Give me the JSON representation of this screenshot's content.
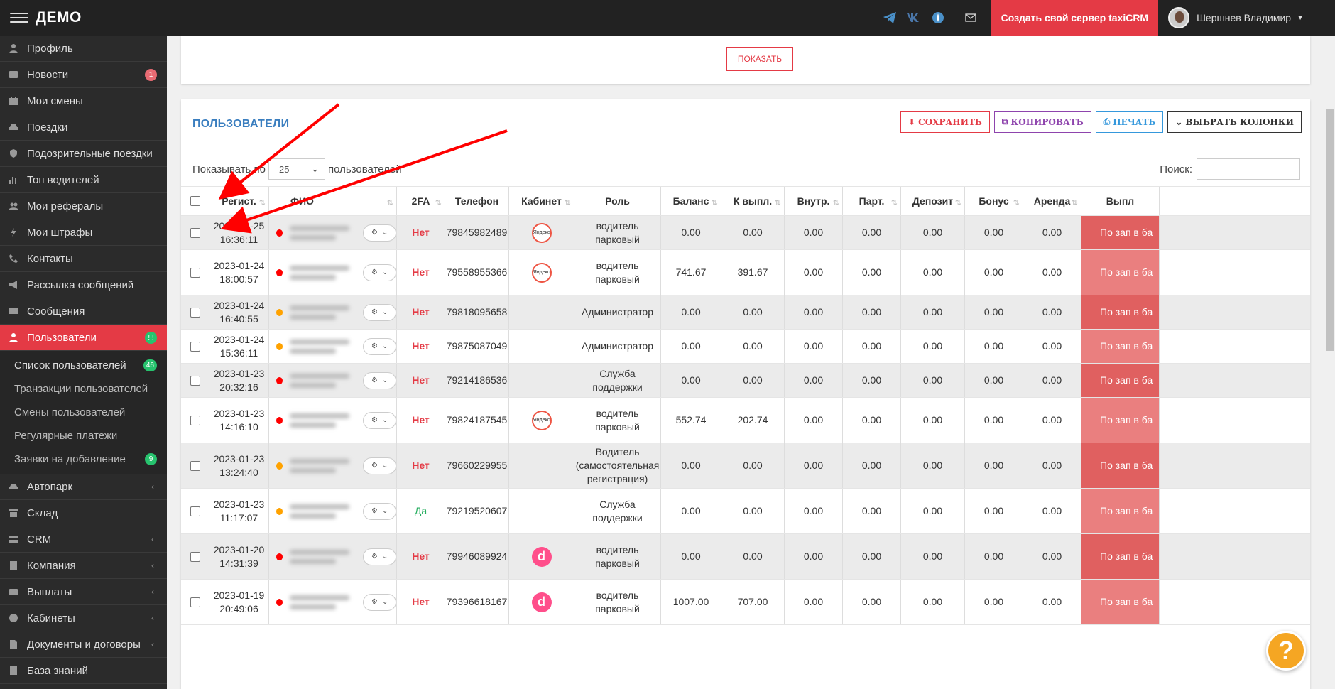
{
  "app": {
    "brand": "ДЕМО",
    "create_server": "Создать свой сервер taxiCRM",
    "user_name": "Шершнев Владимир"
  },
  "sidebar": {
    "items": [
      {
        "label": "Профиль",
        "icon": "user-icon"
      },
      {
        "label": "Новости",
        "icon": "news-icon",
        "badge": "1"
      },
      {
        "label": "Мои смены",
        "icon": "calendar-icon"
      },
      {
        "label": "Поездки",
        "icon": "car-icon"
      },
      {
        "label": "Подозрительные поездки",
        "icon": "shield-icon"
      },
      {
        "label": "Топ водителей",
        "icon": "bar-chart-icon"
      },
      {
        "label": "Мои рефералы",
        "icon": "users-icon"
      },
      {
        "label": "Мои штрафы",
        "icon": "bolt-icon"
      },
      {
        "label": "Контакты",
        "icon": "phone-icon"
      },
      {
        "label": "Рассылка сообщений",
        "icon": "bullhorn-icon"
      },
      {
        "label": "Сообщения",
        "icon": "envelope-icon"
      },
      {
        "label": "Пользователи",
        "icon": "user-icon",
        "badge": "!!!"
      }
    ],
    "subitems": [
      {
        "label": "Список пользователей",
        "badge": "46"
      },
      {
        "label": "Транзакции пользователей"
      },
      {
        "label": "Смены пользователей"
      },
      {
        "label": "Регулярные платежи"
      },
      {
        "label": "Заявки на добавление",
        "badge": "9"
      }
    ],
    "items2": [
      {
        "label": "Автопарк",
        "icon": "car-icon"
      },
      {
        "label": "Склад",
        "icon": "archive-icon"
      },
      {
        "label": "CRM",
        "icon": "server-icon"
      },
      {
        "label": "Компания",
        "icon": "building-icon"
      },
      {
        "label": "Выплаты",
        "icon": "wallet-icon"
      },
      {
        "label": "Кабинеты",
        "icon": "dashboard-icon"
      },
      {
        "label": "Документы и договоры",
        "icon": "document-icon"
      },
      {
        "label": "База знаний",
        "icon": "book-icon"
      }
    ]
  },
  "top_card": {
    "show_button": "ПОКАЗАТЬ"
  },
  "users": {
    "title": "ПОЛЬЗОВАТЕЛИ",
    "buttons": {
      "save": "СОХРАНИТЬ",
      "copy": "КОПИРОВАТЬ",
      "print": "ПЕЧАТЬ",
      "columns": "ВЫБРАТЬ КОЛОНКИ"
    },
    "length_prefix": "Показывать по",
    "length_value": "25",
    "length_suffix": "пользователей",
    "search_label": "Поиск:",
    "search_value": "",
    "columns": [
      "Регист.",
      "ФИО",
      "2FA",
      "Телефон",
      "Кабинет",
      "Роль",
      "Баланс",
      "К выпл.",
      "Внутр.",
      "Парт.",
      "Депозит",
      "Бонус",
      "Аренда",
      "Выпл"
    ],
    "rows": [
      {
        "date": "2023-01-25",
        "time": "16:36:11",
        "status": "red",
        "fa": "Нет",
        "phone": "79845982489",
        "cabinet": "yandex",
        "role": "водитель парковый",
        "balance": "0.00",
        "payout": "0.00",
        "inner": "0.00",
        "part": "0.00",
        "deposit": "0.00",
        "bonus": "0.00",
        "rent": "0.00",
        "pay": "По зап в ба"
      },
      {
        "date": "2023-01-24",
        "time": "18:00:57",
        "status": "red",
        "fa": "Нет",
        "phone": "79558955366",
        "cabinet": "yandex",
        "role": "водитель парковый",
        "balance": "741.67",
        "payout": "391.67",
        "inner": "0.00",
        "part": "0.00",
        "deposit": "0.00",
        "bonus": "0.00",
        "rent": "0.00",
        "pay": "По зап в ба"
      },
      {
        "date": "2023-01-24",
        "time": "16:40:55",
        "status": "orange",
        "fa": "Нет",
        "phone": "79818095658",
        "cabinet": "",
        "role": "Администратор",
        "balance": "0.00",
        "payout": "0.00",
        "inner": "0.00",
        "part": "0.00",
        "deposit": "0.00",
        "bonus": "0.00",
        "rent": "0.00",
        "pay": "По зап в ба"
      },
      {
        "date": "2023-01-24",
        "time": "15:36:11",
        "status": "orange",
        "fa": "Нет",
        "phone": "79875087049",
        "cabinet": "",
        "role": "Администратор",
        "balance": "0.00",
        "payout": "0.00",
        "inner": "0.00",
        "part": "0.00",
        "deposit": "0.00",
        "bonus": "0.00",
        "rent": "0.00",
        "pay": "По зап в ба"
      },
      {
        "date": "2023-01-23",
        "time": "20:32:16",
        "status": "red",
        "fa": "Нет",
        "phone": "79214186536",
        "cabinet": "",
        "role": "Служба поддержки",
        "balance": "0.00",
        "payout": "0.00",
        "inner": "0.00",
        "part": "0.00",
        "deposit": "0.00",
        "bonus": "0.00",
        "rent": "0.00",
        "pay": "По зап в ба"
      },
      {
        "date": "2023-01-23",
        "time": "14:16:10",
        "status": "red",
        "fa": "Нет",
        "phone": "79824187545",
        "cabinet": "yandex",
        "role": "водитель парковый",
        "balance": "552.74",
        "payout": "202.74",
        "inner": "0.00",
        "part": "0.00",
        "deposit": "0.00",
        "bonus": "0.00",
        "rent": "0.00",
        "pay": "По зап в ба"
      },
      {
        "date": "2023-01-23",
        "time": "13:24:40",
        "status": "orange",
        "fa": "Нет",
        "phone": "79660229955",
        "cabinet": "",
        "role": "Водитель (самостоятельная регистрация)",
        "balance": "0.00",
        "payout": "0.00",
        "inner": "0.00",
        "part": "0.00",
        "deposit": "0.00",
        "bonus": "0.00",
        "rent": "0.00",
        "pay": "По зап в ба"
      },
      {
        "date": "2023-01-23",
        "time": "11:17:07",
        "status": "orange",
        "fa": "Да",
        "phone": "79219520607",
        "cabinet": "",
        "role": "Служба поддержки",
        "balance": "0.00",
        "payout": "0.00",
        "inner": "0.00",
        "part": "0.00",
        "deposit": "0.00",
        "bonus": "0.00",
        "rent": "0.00",
        "pay": "По зап в ба"
      },
      {
        "date": "2023-01-20",
        "time": "14:31:39",
        "status": "red",
        "fa": "Нет",
        "phone": "79946089924",
        "cabinet": "d",
        "role": "водитель парковый",
        "balance": "0.00",
        "payout": "0.00",
        "inner": "0.00",
        "part": "0.00",
        "deposit": "0.00",
        "bonus": "0.00",
        "rent": "0.00",
        "pay": "По зап в ба"
      },
      {
        "date": "2023-01-19",
        "time": "20:49:06",
        "status": "red",
        "fa": "Нет",
        "phone": "79396618167",
        "cabinet": "d",
        "role": "водитель парковый",
        "balance": "1007.00",
        "payout": "707.00",
        "inner": "0.00",
        "part": "0.00",
        "deposit": "0.00",
        "bonus": "0.00",
        "rent": "0.00",
        "pay": "По зап в ба"
      }
    ]
  },
  "colors": {
    "accent": "#e43a45",
    "title_blue": "#3a7ebf",
    "sidebar": "#2b2b2b",
    "topbar": "#222222",
    "pay_cell": "#e06060"
  },
  "help_icon": "question-icon"
}
